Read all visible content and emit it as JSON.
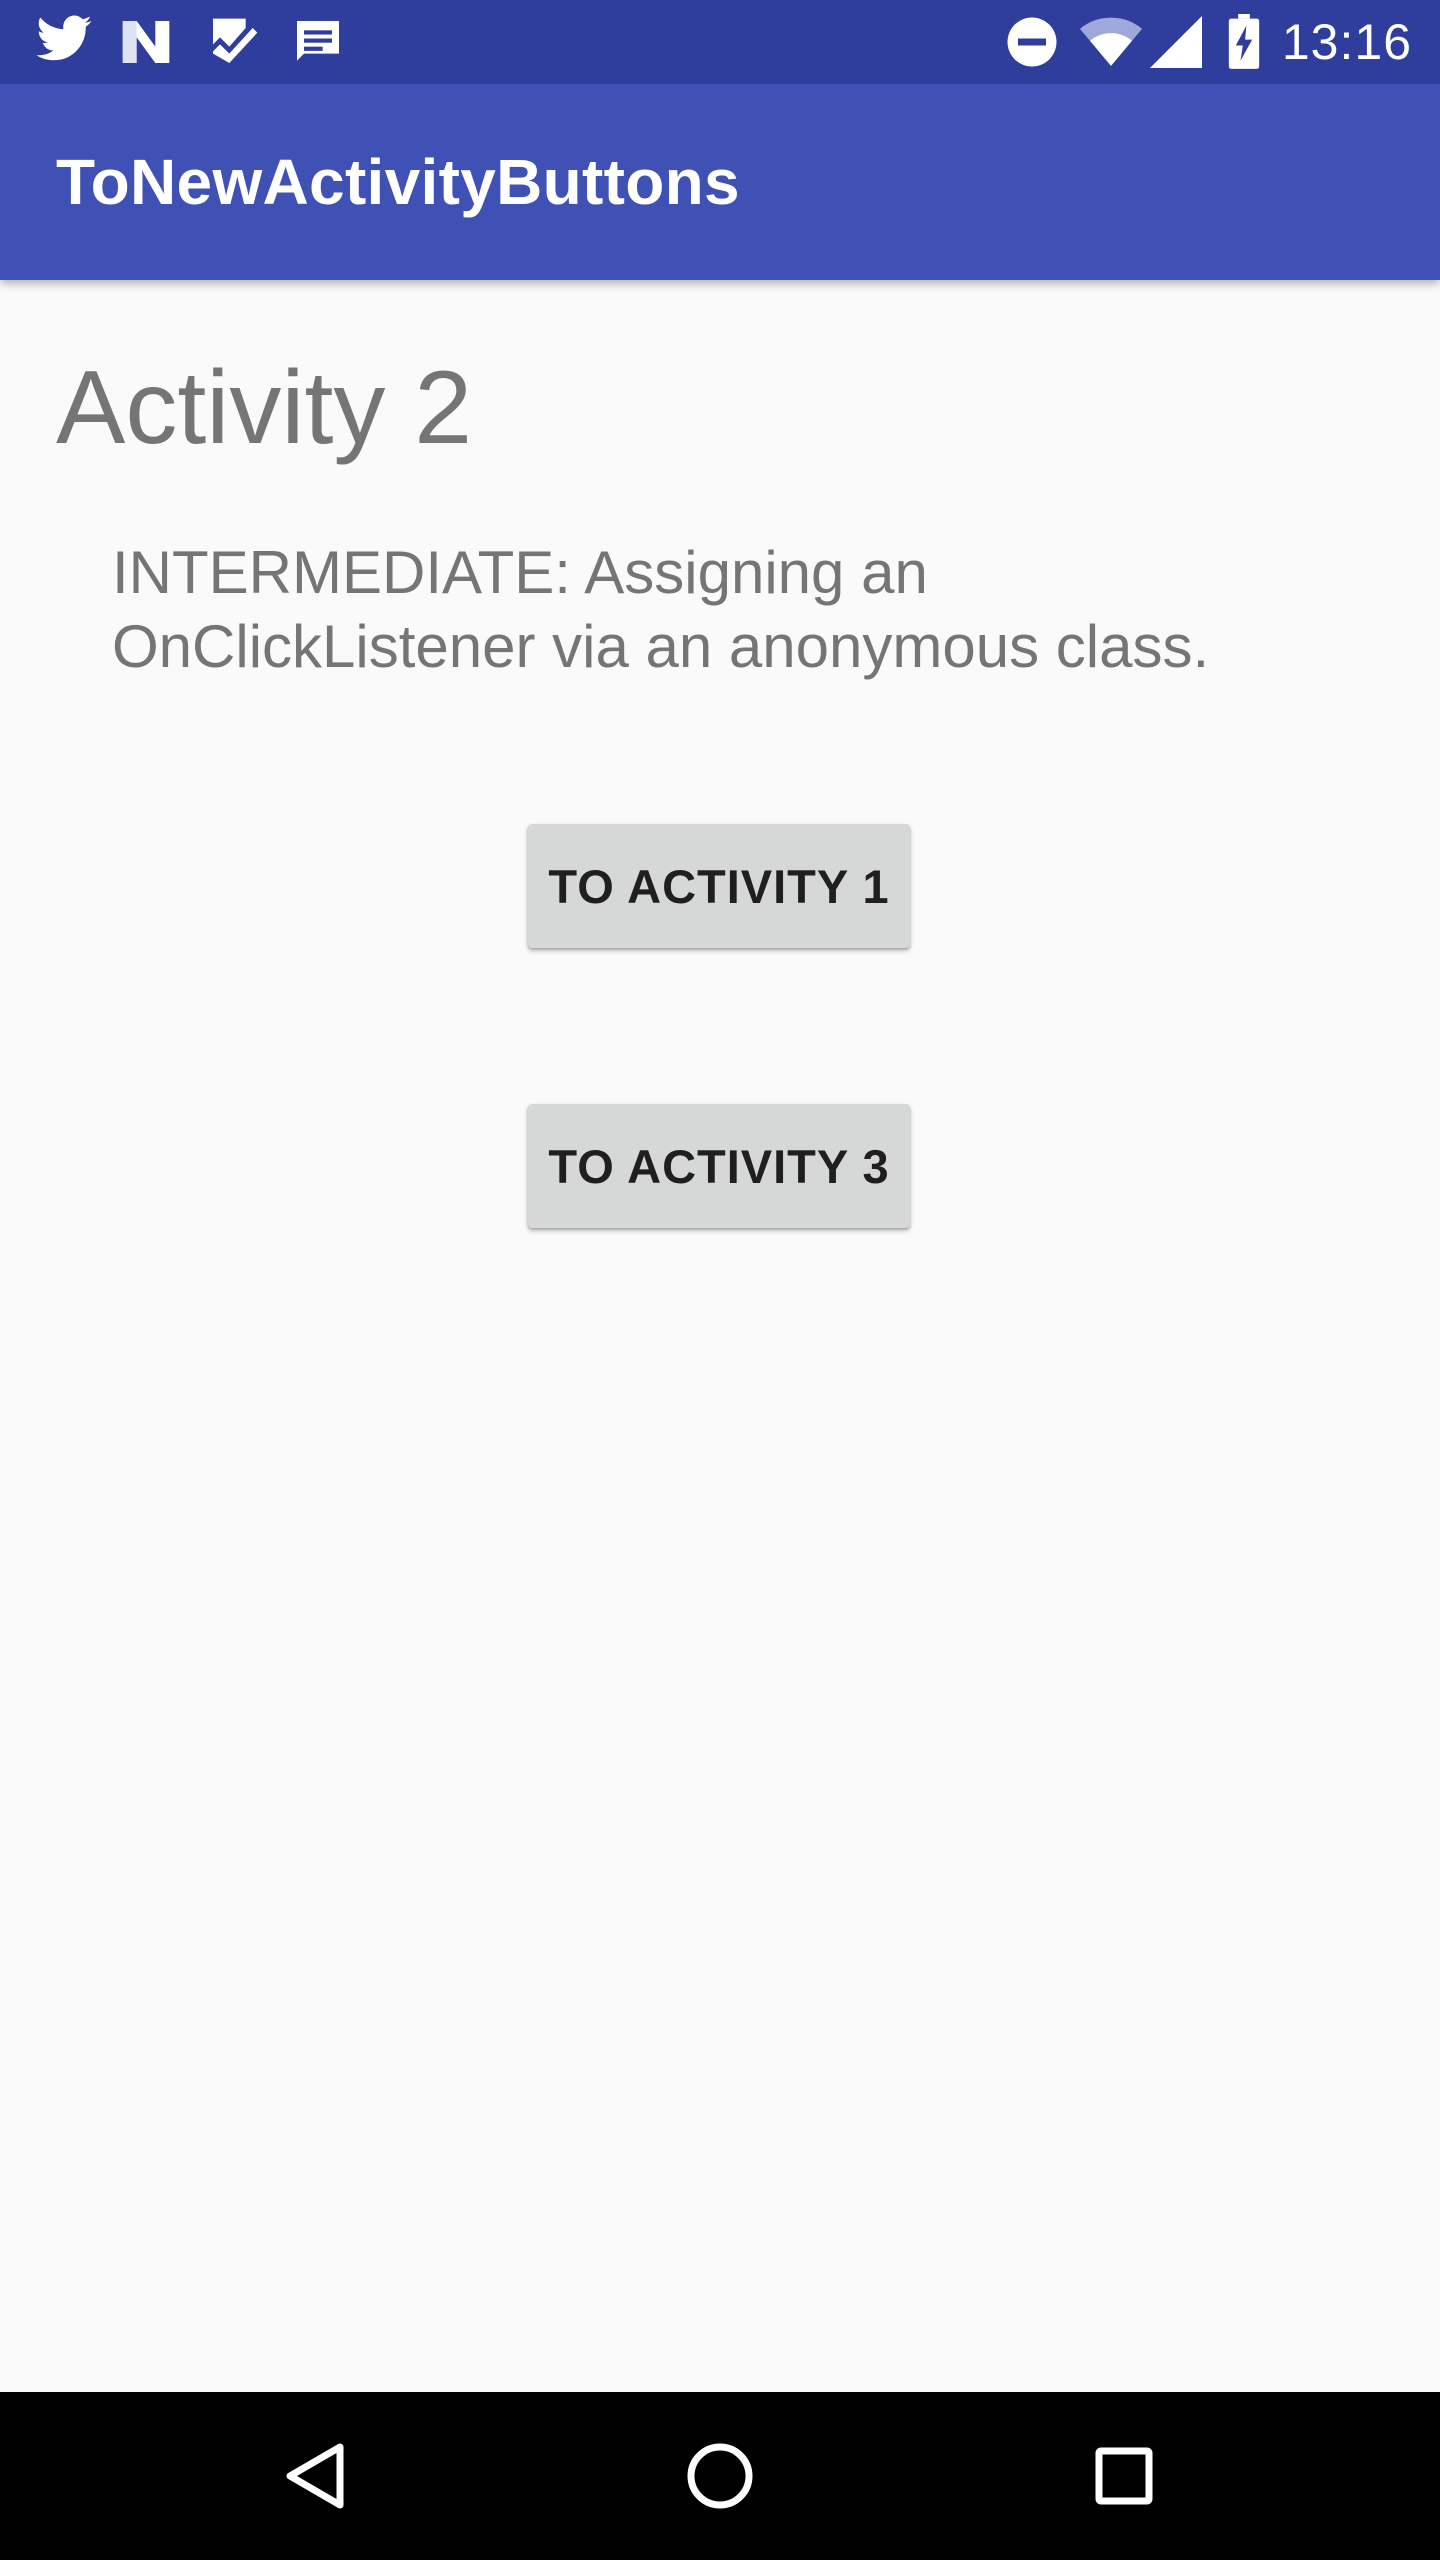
{
  "status_bar": {
    "time": "13:16",
    "left_icons": [
      "twitter-icon",
      "n-app-icon",
      "check-inbox-icon",
      "message-icon"
    ],
    "right_icons": [
      "do-not-disturb-icon",
      "wifi-icon",
      "cell-signal-icon",
      "battery-charging-icon"
    ]
  },
  "app_bar": {
    "title": "ToNewActivityButtons"
  },
  "main": {
    "heading": "Activity 2",
    "description": "INTERMEDIATE: Assigning an OnClickListener via an anonymous class.",
    "buttons": [
      {
        "label": "TO ACTIVITY 1"
      },
      {
        "label": "TO ACTIVITY 3"
      }
    ]
  },
  "nav_bar": {
    "icons": [
      "back-icon",
      "home-icon",
      "recents-icon"
    ]
  },
  "colors": {
    "status_bar": "#2f3e9c",
    "app_bar": "#3f51b5",
    "background": "#fafafa",
    "text_secondary": "#757575",
    "button": "#d6d7d7"
  }
}
